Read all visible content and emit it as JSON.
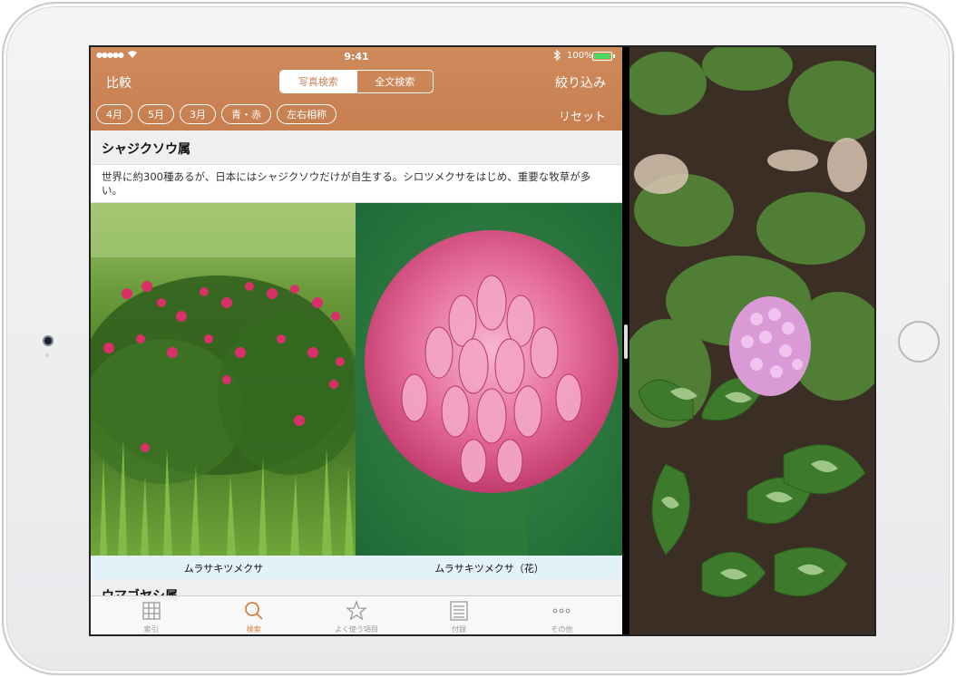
{
  "status_bar": {
    "signal": "●●●●●",
    "time": "9:41",
    "battery_percent": "100%"
  },
  "nav": {
    "left_label": "比較",
    "right_label": "絞り込み",
    "segments": [
      "写真検索",
      "全文検索"
    ],
    "active_segment": 0
  },
  "filters": {
    "chips": [
      "4月",
      "5月",
      "3月",
      "青・赤",
      "左右相称"
    ],
    "reset_label": "リセット"
  },
  "section": {
    "title": "シャジクソウ属",
    "description": "世界に約300種あるが、日本にはシャジクソウだけが自生する。シロツメクサをはじめ、重要な牧草が多い。"
  },
  "photos": [
    {
      "caption": "ムラサキツメクサ",
      "icon": "clover-field-photo"
    },
    {
      "caption": "ムラサキツメクサ（花）",
      "icon": "clover-flower-closeup-photo"
    }
  ],
  "next_section": {
    "title": "ウマゴヤシ属"
  },
  "tabbar": {
    "active": 1,
    "tabs": [
      {
        "label": "索引",
        "icon": "grid-icon"
      },
      {
        "label": "検索",
        "icon": "search-icon"
      },
      {
        "label": "よく使う項目",
        "icon": "star-icon"
      },
      {
        "label": "付録",
        "icon": "list-icon"
      },
      {
        "label": "その他",
        "icon": "more-icon"
      }
    ]
  },
  "colors": {
    "accent": "#c97f50",
    "tab_active": "#d6813f",
    "caption_bg": "#e3f1f9"
  }
}
